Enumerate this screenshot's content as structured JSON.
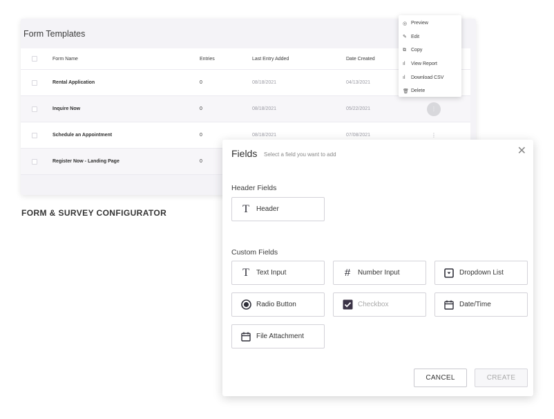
{
  "templates": {
    "title": "Form Templates",
    "columns": {
      "name": "Form Name",
      "entries": "Entries",
      "last_entry": "Last Entry Added",
      "created": "Date Created"
    },
    "rows": [
      {
        "name": "Rental Application",
        "entries": "0",
        "last_entry": "08/18/2021",
        "created": "04/13/2021"
      },
      {
        "name": "Inquire Now",
        "entries": "0",
        "last_entry": "08/18/2021",
        "created": "05/22/2021"
      },
      {
        "name": "Schedule an Appointment",
        "entries": "0",
        "last_entry": "08/18/2021",
        "created": "07/08/2021"
      },
      {
        "name": "Register Now - Landing Page",
        "entries": "0",
        "last_entry": "",
        "created": ""
      }
    ],
    "row_action_icon": "more-vertical-icon"
  },
  "menu": {
    "items": [
      {
        "label": "Preview",
        "icon": "eye-icon"
      },
      {
        "label": "Edit",
        "icon": "pencil-icon"
      },
      {
        "label": "Copy",
        "icon": "copy-icon"
      },
      {
        "label": "View Report",
        "icon": "bar-chart-icon"
      },
      {
        "label": "Download CSV",
        "icon": "bar-chart-icon"
      },
      {
        "label": "Delete",
        "icon": "trash-icon"
      }
    ]
  },
  "caption": "FORM & SURVEY CONFIGURATOR",
  "modal": {
    "title": "Fields",
    "subtitle": "Select a field you want to add",
    "close_icon": "close-icon",
    "header_group": {
      "label": "Header Fields",
      "fields": [
        {
          "label": "Header",
          "icon": "text-icon"
        }
      ]
    },
    "custom_group": {
      "label": "Custom Fields",
      "fields": [
        {
          "label": "Text Input",
          "icon": "text-icon"
        },
        {
          "label": "Number Input",
          "icon": "hash-icon"
        },
        {
          "label": "Dropdown List",
          "icon": "dropdown-icon"
        },
        {
          "label": "Radio Button",
          "icon": "radio-icon"
        },
        {
          "label": "Checkbox",
          "icon": "checkbox-icon"
        },
        {
          "label": "Date/Time",
          "icon": "calendar-icon"
        },
        {
          "label": "File Attachment",
          "icon": "calendar-icon"
        }
      ]
    },
    "cancel_label": "CANCEL",
    "create_label": "CREATE"
  },
  "colors": {
    "card_bg": "#f4f3f7",
    "accent_dark": "#2e2e38",
    "checkbox_fill": "#3b3346",
    "disabled_text": "#aaaaaa"
  }
}
